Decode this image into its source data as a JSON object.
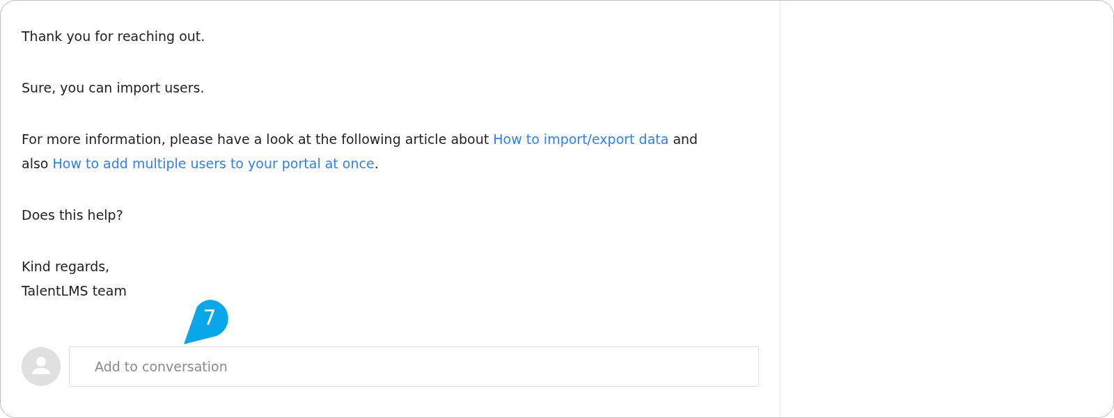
{
  "message": {
    "paragraphs": [
      {
        "kind": "paragraph",
        "parts": [
          {
            "kind": "text",
            "text": "Thank you for reaching out."
          }
        ]
      },
      {
        "kind": "paragraph",
        "parts": [
          {
            "kind": "text",
            "text": "Sure, you can import users."
          }
        ]
      },
      {
        "kind": "paragraph",
        "parts": [
          {
            "kind": "text",
            "text": "For more information, please have a look at the following article about "
          },
          {
            "kind": "link",
            "text": "How to import/export data"
          },
          {
            "kind": "text",
            "text": " and also "
          },
          {
            "kind": "link",
            "text": "How to add multiple users to your portal at once"
          },
          {
            "kind": "text",
            "text": "."
          }
        ]
      },
      {
        "kind": "paragraph",
        "parts": [
          {
            "kind": "text",
            "text": "Does this help?"
          }
        ]
      },
      {
        "kind": "signature",
        "lines": [
          "Kind regards,",
          "TalentLMS team"
        ]
      }
    ]
  },
  "callout": {
    "number": "7"
  },
  "reply": {
    "placeholder": "Add to conversation"
  }
}
